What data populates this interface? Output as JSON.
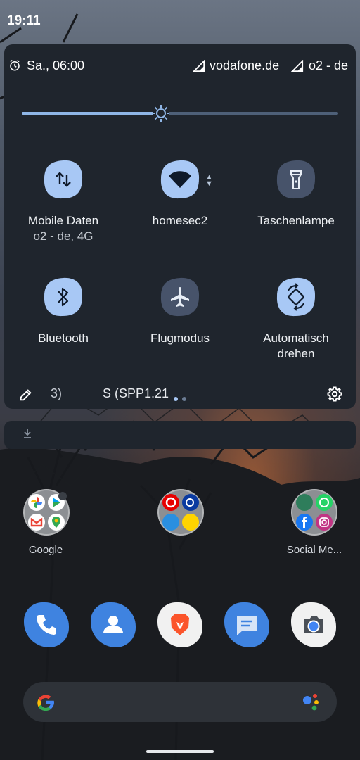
{
  "status_bar": {
    "time": "19:11"
  },
  "quick_settings": {
    "alarm_text": "Sa., 06:00",
    "carrier_1": "vodafone.de",
    "carrier_2": "o2 - de",
    "brightness_fraction": 0.44,
    "tiles": [
      {
        "label": "Mobile Daten",
        "subtitle": "o2 - de, 4G",
        "icon": "swap-vertical-icon",
        "active": true
      },
      {
        "label": "homesec2",
        "subtitle": "",
        "icon": "wifi-icon",
        "active": true
      },
      {
        "label": "Taschenlampe",
        "subtitle": "",
        "icon": "flashlight-icon",
        "active": false
      },
      {
        "label": "Bluetooth",
        "subtitle": "",
        "icon": "bluetooth-icon",
        "active": true
      },
      {
        "label": "Flugmodus",
        "subtitle": "",
        "icon": "airplane-icon",
        "active": false
      },
      {
        "label": "Automatisch",
        "subtitle": "drehen",
        "icon": "auto-rotate-icon",
        "active": true
      }
    ],
    "footer": {
      "build_text_left": "3)",
      "build_text_right": "S (SPP1.21"
    }
  },
  "home": {
    "folders": [
      {
        "label": "Google"
      },
      {
        "label": ""
      },
      {
        "label": "Social Me..."
      }
    ],
    "dock": [
      "phone-icon",
      "contacts-icon",
      "brave-browser-icon",
      "messages-icon",
      "camera-icon"
    ]
  },
  "colors": {
    "active_tile": "#a8c8f5",
    "inactive_tile": "#47536a",
    "panel": "#1f252d",
    "accent": "#8fb6e6"
  }
}
